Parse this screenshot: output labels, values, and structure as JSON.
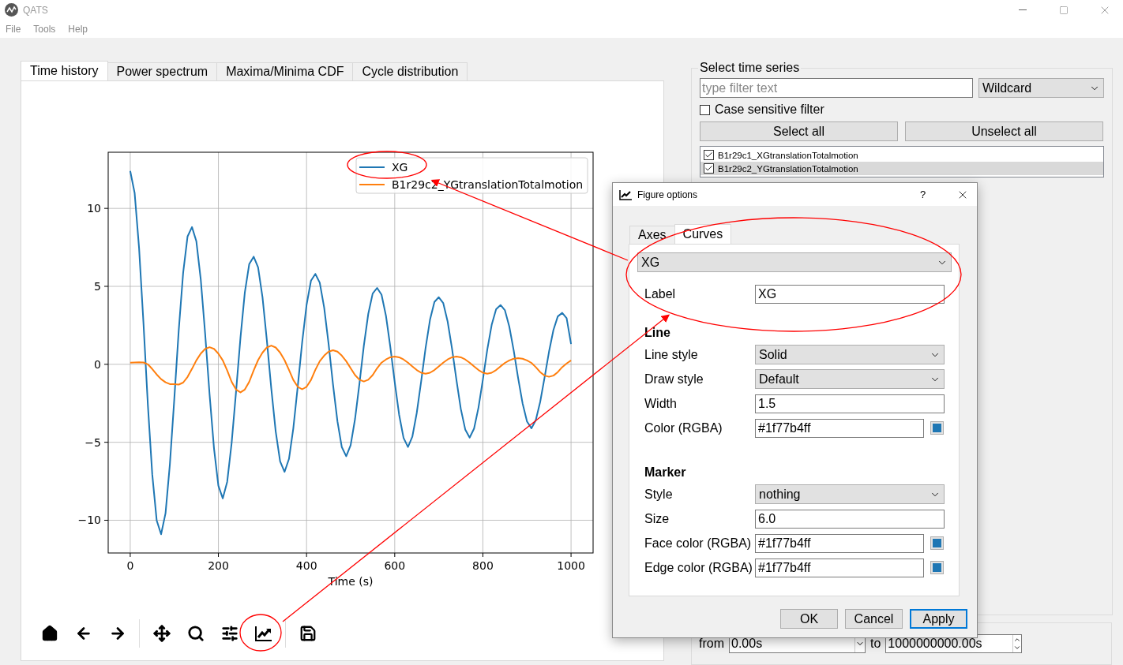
{
  "window": {
    "title": "QATS"
  },
  "menu": [
    "File",
    "Tools",
    "Help"
  ],
  "tabs": [
    {
      "label": "Time history",
      "selected": true
    },
    {
      "label": "Power spectrum",
      "selected": false
    },
    {
      "label": "Maxima/Minima CDF",
      "selected": false
    },
    {
      "label": "Cycle distribution",
      "selected": false
    }
  ],
  "plot": {
    "chart_data": {
      "type": "line",
      "grid": true,
      "legend": true,
      "xlabel": "Time (s)",
      "xlim": [
        -50,
        1050
      ],
      "ylim": [
        -12.1,
        13.6
      ],
      "xticks": [
        0,
        200,
        400,
        600,
        800,
        1000
      ],
      "yticks": [
        {
          "value": -10,
          "label": "−10"
        },
        {
          "value": -5,
          "label": "−5"
        },
        0,
        5,
        10
      ],
      "x": [
        0,
        10,
        20,
        30,
        40,
        50,
        60,
        70,
        80,
        90,
        100,
        110,
        120,
        130,
        140,
        150,
        160,
        170,
        180,
        190,
        200,
        210,
        220,
        230,
        240,
        250,
        260,
        270,
        280,
        290,
        300,
        310,
        320,
        330,
        340,
        350,
        360,
        370,
        380,
        390,
        400,
        410,
        420,
        430,
        440,
        450,
        460,
        470,
        480,
        490,
        500,
        510,
        520,
        530,
        540,
        550,
        560,
        570,
        580,
        590,
        600,
        610,
        620,
        630,
        640,
        650,
        660,
        670,
        680,
        690,
        700,
        710,
        720,
        730,
        740,
        750,
        760,
        770,
        780,
        790,
        800,
        810,
        820,
        830,
        840,
        850,
        860,
        870,
        880,
        890,
        900,
        910,
        920,
        930,
        940,
        950,
        960,
        970,
        980,
        990,
        1000
      ],
      "series": [
        {
          "name": "XG",
          "color": "#1f77b4",
          "values": [
            12.4,
            10.98,
            7.46,
            2.62,
            -2.57,
            -7.06,
            -10.01,
            -10.9,
            -9.55,
            -6.42,
            -2.23,
            2.16,
            5.86,
            8.2,
            8.8,
            7.9,
            5.45,
            1.94,
            -1.94,
            -5.4,
            -7.78,
            -8.6,
            -7.53,
            -5.05,
            -1.76,
            1.7,
            4.6,
            6.43,
            6.9,
            6.22,
            4.3,
            1.54,
            -1.54,
            -4.3,
            -6.22,
            -6.9,
            -6.07,
            -4.11,
            -1.43,
            1.4,
            3.81,
            5.37,
            5.8,
            5.23,
            3.63,
            1.3,
            -1.31,
            -3.66,
            -5.31,
            -5.9,
            -5.19,
            -3.5,
            -1.22,
            1.19,
            3.23,
            4.54,
            4.9,
            4.47,
            3.12,
            1.13,
            -1.14,
            -3.23,
            -4.72,
            -5.3,
            -4.65,
            -3.12,
            -1.09,
            1.05,
            2.86,
            4,
            4.3,
            3.93,
            2.75,
            1,
            -1.01,
            -2.86,
            -4.18,
            -4.7,
            -4.12,
            -2.77,
            -0.96,
            0.93,
            2.53,
            3.54,
            3.8,
            3.46,
            2.42,
            0.88,
            -0.89,
            -2.5,
            -3.66,
            -4.1,
            -3.59,
            -2.41,
            -0.84,
            0.81,
            2.2,
            3.07,
            3.3,
            2.96,
            1.3
          ]
        },
        {
          "name": "B1r29c2_YGtranslationTotalmotion",
          "color": "#ff7f0e",
          "values": [
            0.1,
            0.12,
            0.13,
            0.12,
            0,
            -0.3,
            -0.65,
            -0.95,
            -1.15,
            -1.27,
            -1.28,
            -1.3,
            -1.17,
            -0.81,
            -0.29,
            0.25,
            0.69,
            0.99,
            1.1,
            0.99,
            0.69,
            0.25,
            -0.4,
            -1.12,
            -1.62,
            -1.8,
            -1.62,
            -1.12,
            -0.4,
            0.27,
            0.75,
            1.08,
            1.2,
            1.08,
            0.75,
            0.27,
            -0.36,
            -1,
            -1.44,
            -1.6,
            -1.44,
            -1,
            -0.36,
            0.2,
            0.56,
            0.81,
            0.9,
            0.81,
            0.56,
            0.2,
            -0.25,
            -0.69,
            -0.99,
            -1.1,
            -0.99,
            -0.69,
            -0.25,
            0.11,
            0.31,
            0.45,
            0.5,
            0.45,
            0.31,
            0.11,
            -0.13,
            -0.37,
            -0.54,
            -0.6,
            -0.54,
            -0.37,
            -0.13,
            0.11,
            0.31,
            0.45,
            0.5,
            0.45,
            0.31,
            0.11,
            -0.13,
            -0.37,
            -0.54,
            -0.6,
            -0.54,
            -0.37,
            -0.13,
            0.09,
            0.25,
            0.36,
            0.4,
            0.36,
            0.25,
            0.09,
            -0.18,
            -0.5,
            -0.72,
            -0.8,
            -0.72,
            -0.5,
            -0.18,
            0.05,
            0.25
          ]
        }
      ]
    }
  },
  "toolbar": [
    {
      "kind": "home"
    },
    {
      "kind": "back"
    },
    {
      "kind": "forward"
    },
    {
      "kind": "separator"
    },
    {
      "kind": "pan"
    },
    {
      "kind": "zoom"
    },
    {
      "kind": "subplots"
    },
    {
      "kind": "options"
    },
    {
      "kind": "separator"
    },
    {
      "kind": "save"
    }
  ],
  "series_panel": {
    "title": "Select time series",
    "filter": {
      "placeholder": "type filter text"
    },
    "mode": "Wildcard",
    "case_sensitive": {
      "label": "Case sensitive filter",
      "checked": false
    },
    "buttons": [
      "Select all",
      "Unselect all"
    ],
    "items": [
      {
        "name": "B1r29c1_XGtranslationTotalmotion",
        "checked": true,
        "selected": false
      },
      {
        "name": "B1r29c2_YGtranslationTotalmotion",
        "checked": true,
        "selected": true
      }
    ]
  },
  "range": {
    "from_label": "from",
    "from": "0.00s",
    "to_label": "to",
    "to": "1000000000.00s"
  },
  "dialog": {
    "title": "Figure options",
    "help": "?",
    "tabs": [
      {
        "label": "Axes",
        "selected": false
      },
      {
        "label": "Curves",
        "selected": true
      }
    ],
    "curve": "XG",
    "label_field": {
      "label": "Label",
      "value": "XG"
    },
    "sections": [
      {
        "heading": "Line",
        "fields": [
          {
            "kind": "select",
            "label": "Line style",
            "value": "Solid"
          },
          {
            "kind": "select",
            "label": "Draw style",
            "value": "Default"
          },
          {
            "kind": "text",
            "label": "Width",
            "value": "1.5"
          },
          {
            "kind": "color",
            "label": "Color (RGBA)",
            "value": "#1f77b4ff",
            "color": "#1f77b4"
          }
        ]
      },
      {
        "heading": "Marker",
        "fields": [
          {
            "kind": "select",
            "label": "Style",
            "value": "nothing"
          },
          {
            "kind": "text",
            "label": "Size",
            "value": "6.0"
          },
          {
            "kind": "color",
            "label": "Face color (RGBA)",
            "value": "#1f77b4ff",
            "color": "#1f77b4"
          },
          {
            "kind": "color",
            "label": "Edge color (RGBA)",
            "value": "#1f77b4ff",
            "color": "#1f77b4"
          }
        ]
      }
    ],
    "buttons": [
      {
        "label": "OK",
        "default": false
      },
      {
        "label": "Cancel",
        "default": false
      },
      {
        "label": "Apply",
        "default": true
      }
    ]
  }
}
